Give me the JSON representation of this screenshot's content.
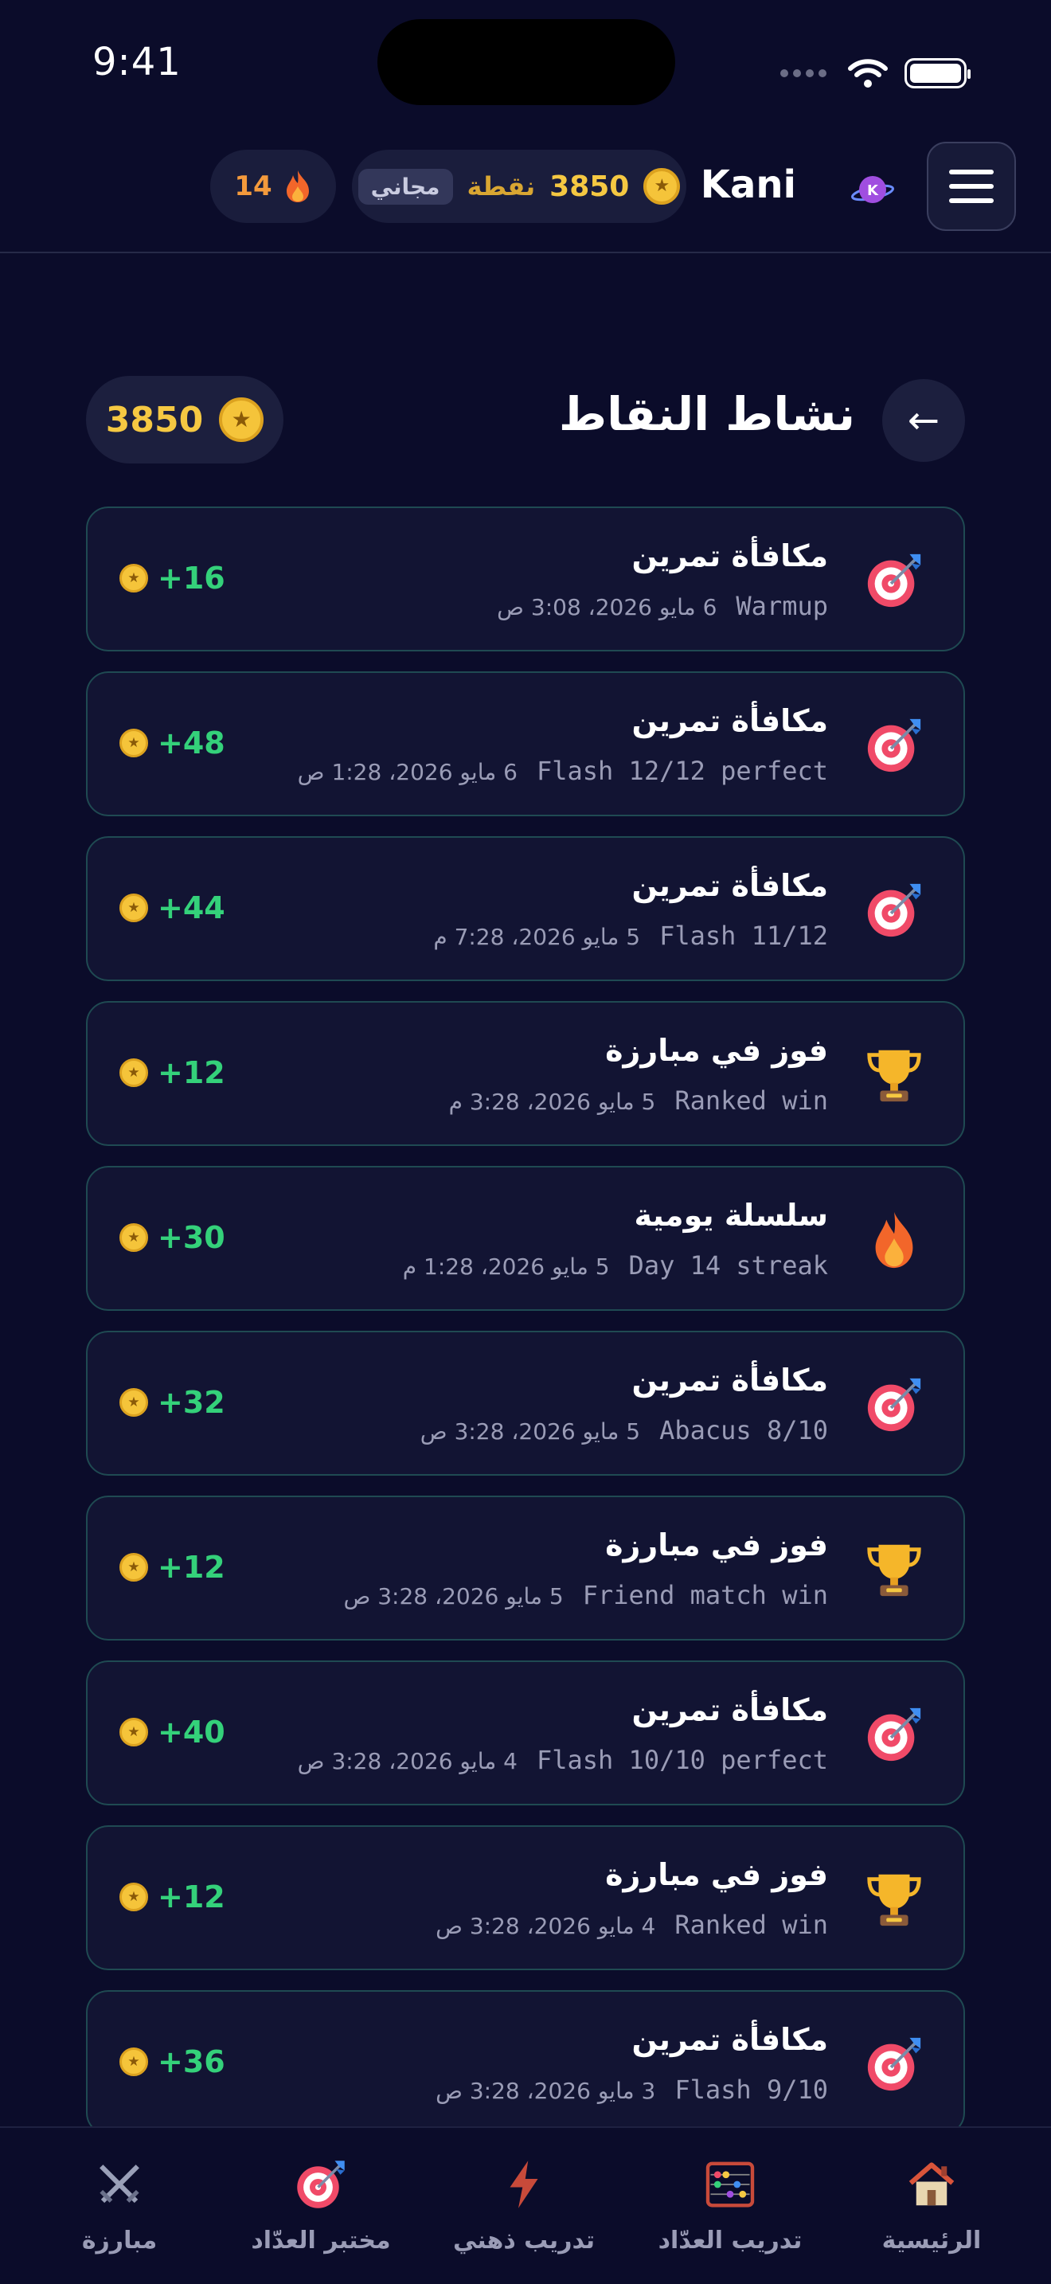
{
  "status_bar": {
    "time": "9:41"
  },
  "header": {
    "user_name": "Kani",
    "avatar_initial": "K",
    "points_value": "3850",
    "points_unit": "نقطة",
    "plan_tag": "مجاني",
    "streak_count": "14"
  },
  "page": {
    "title": "نشاط النقاط",
    "back_label": "←",
    "balance": "3850"
  },
  "activities": [
    {
      "icon": "target-icon",
      "title": "مكافأة تمرين",
      "note": "Warmup",
      "date": "6 مايو 2026، 3:08 ص",
      "points": "16+"
    },
    {
      "icon": "target-icon",
      "title": "مكافأة تمرين",
      "note": "Flash 12/12 perfect",
      "date": "6 مايو 2026، 1:28 ص",
      "points": "48+"
    },
    {
      "icon": "target-icon",
      "title": "مكافأة تمرين",
      "note": "Flash 11/12",
      "date": "5 مايو 2026، 7:28 م",
      "points": "44+"
    },
    {
      "icon": "trophy-icon",
      "title": "فوز في مبارزة",
      "note": "Ranked win",
      "date": "5 مايو 2026، 3:28 م",
      "points": "12+"
    },
    {
      "icon": "fire-icon",
      "title": "سلسلة يومية",
      "note": "Day 14 streak",
      "date": "5 مايو 2026، 1:28 م",
      "points": "30+"
    },
    {
      "icon": "target-icon",
      "title": "مكافأة تمرين",
      "note": "Abacus 8/10",
      "date": "5 مايو 2026، 3:28 ص",
      "points": "32+"
    },
    {
      "icon": "trophy-icon",
      "title": "فوز في مبارزة",
      "note": "Friend match win",
      "date": "5 مايو 2026، 3:28 ص",
      "points": "12+"
    },
    {
      "icon": "target-icon",
      "title": "مكافأة تمرين",
      "note": "Flash 10/10 perfect",
      "date": "4 مايو 2026، 3:28 ص",
      "points": "40+"
    },
    {
      "icon": "trophy-icon",
      "title": "فوز في مبارزة",
      "note": "Ranked win",
      "date": "4 مايو 2026، 3:28 ص",
      "points": "12+"
    },
    {
      "icon": "target-icon",
      "title": "مكافأة تمرين",
      "note": "Flash 9/10",
      "date": "3 مايو 2026، 3:28 ص",
      "points": "36+"
    }
  ],
  "bottom_nav": [
    {
      "label": "الرئيسية",
      "icon": "house-icon"
    },
    {
      "label": "تدريب العدّاد",
      "icon": "abacus-icon"
    },
    {
      "label": "تدريب ذهني",
      "icon": "lightning-icon"
    },
    {
      "label": "مختبر العدّاد",
      "icon": "target-icon"
    },
    {
      "label": "مبارزة",
      "icon": "crossed-swords-icon"
    }
  ],
  "colors": {
    "background": "#0b0c2a",
    "card": "#121433",
    "card_border": "#1f4a52",
    "coin": "#f5c43a",
    "positive": "#34d17a",
    "muted_text": "#9a9cb6"
  }
}
